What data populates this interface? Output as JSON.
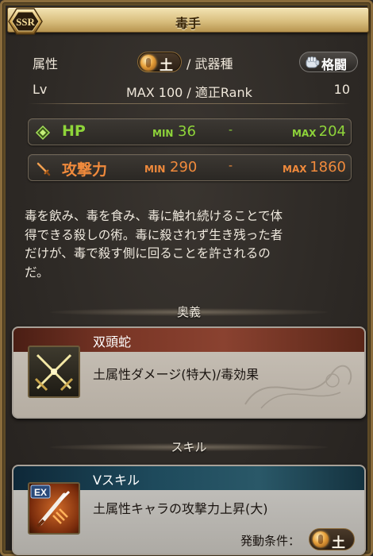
{
  "header": {
    "title": "毒手",
    "rarity": "SSR"
  },
  "attribute": {
    "label": "属性",
    "element": "土",
    "weapon_type_label": "/ 武器種",
    "weapon_type": "格闘"
  },
  "level": {
    "label": "Lv",
    "max_text": "MAX 100 / 適正Rank",
    "rank": "10"
  },
  "stats": {
    "hp": {
      "name": "HP",
      "min_label": "MIN",
      "min": "36",
      "dash": "-",
      "max_label": "MAX",
      "max": "204"
    },
    "atk": {
      "name": "攻撃力",
      "min_label": "MIN",
      "min": "290",
      "dash": "-",
      "max_label": "MAX",
      "max": "1860"
    }
  },
  "description": {
    "line1": "毒を飲み、毒を食み、毒に触れ続けることで体",
    "line2": "得できる殺しの術。毒に殺されず生き残った者",
    "line3": "だけが、毒で殺す側に回ることを許されるの",
    "line4": "だ。"
  },
  "ougi": {
    "section_label": "奥義",
    "name": "双頭蛇",
    "effect": "土属性ダメージ(特大)/毒効果"
  },
  "skill": {
    "section_label": "スキル",
    "name": "Vスキル",
    "effect": "土属性キャラの攻撃力上昇(大)",
    "icon_badge": "EX",
    "condition_label": "発動条件：",
    "condition_element": "土"
  },
  "colors": {
    "hp": "#8ed43a",
    "atk": "#f08a3c",
    "frame_gold": "#8a6c3c"
  },
  "icons": [
    "ssr-badge-icon",
    "earth-element-icon",
    "fist-icon",
    "hp-diamond-icon",
    "sword-icon",
    "crossed-swords-icon",
    "ex-skill-icon"
  ]
}
